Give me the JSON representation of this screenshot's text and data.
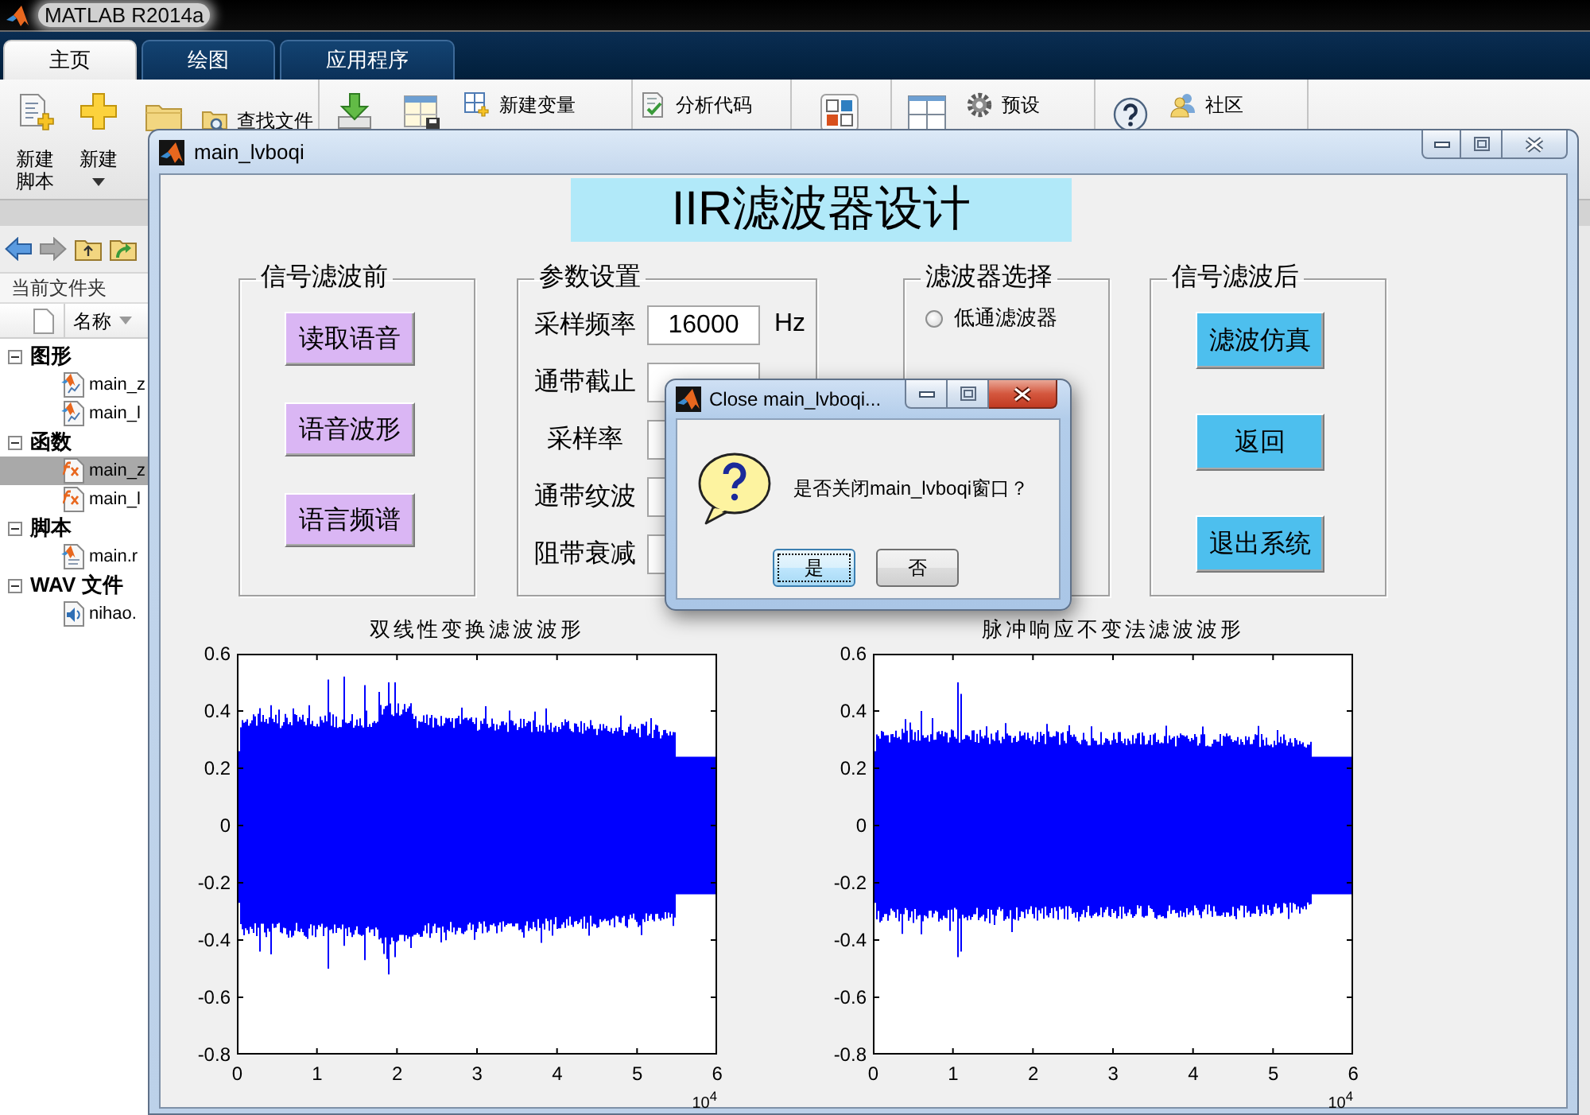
{
  "matlab_window": {
    "title": "MATLAB R2014a"
  },
  "ribbon_tabs": [
    {
      "label": "主页",
      "selected": true
    },
    {
      "label": "绘图",
      "selected": false
    },
    {
      "label": "应用程序",
      "selected": false
    }
  ],
  "toolstrip": {
    "new_script": "新建脚本",
    "new": "新建",
    "find_files": "查找文件",
    "new_variable": "新建变量",
    "analyze_code": "分析代码",
    "preferences": "预设",
    "community": "社区"
  },
  "current_folder": {
    "title": "当前文件夹",
    "column": "名称",
    "groups": [
      {
        "label": "图形",
        "kind": "figure",
        "expanded": true,
        "children": [
          {
            "name": "main_z",
            "selected": false
          },
          {
            "name": "main_l",
            "selected": false
          }
        ]
      },
      {
        "label": "函数",
        "kind": "function",
        "expanded": true,
        "children": [
          {
            "name": "main_z",
            "selected": true
          },
          {
            "name": "main_l",
            "selected": false
          }
        ]
      },
      {
        "label": "脚本",
        "kind": "script",
        "expanded": true,
        "children": [
          {
            "name": "main.r",
            "selected": false
          }
        ]
      },
      {
        "label": "WAV 文件",
        "kind": "audio",
        "expanded": true,
        "children": [
          {
            "name": "nihao.",
            "selected": false
          }
        ]
      }
    ]
  },
  "figure_window": {
    "title": "main_lvboqi",
    "heading": "IIR滤波器设计",
    "panels": [
      {
        "kind": "buttons",
        "title": "信号滤波前",
        "color": "#dab6f4",
        "buttons": [
          "读取语音",
          "语音波形",
          "语言频谱"
        ]
      },
      {
        "kind": "params",
        "title": "参数设置",
        "rows": [
          {
            "label": "采样频率",
            "value": "16000",
            "unit": "Hz"
          },
          {
            "label": "通带截止"
          },
          {
            "label": "采样率"
          },
          {
            "label": "通带纹波"
          },
          {
            "label": "阻带衰减"
          }
        ]
      },
      {
        "kind": "radios",
        "title": "滤波器选择",
        "options": [
          {
            "label": "低通滤波器",
            "selected": false
          }
        ]
      },
      {
        "kind": "buttons",
        "title": "信号滤波后",
        "color": "#4dbfee",
        "buttons": [
          "滤波仿真",
          "返回",
          "退出系统"
        ]
      }
    ],
    "plots": [
      {
        "title": "双线性变换滤波波形",
        "y_tick_labels": [
          "0.6",
          "0.4",
          "0.2",
          "0",
          "-0.2",
          "-0.4",
          "-0.6",
          "-0.8"
        ],
        "x_tick_labels": [
          "0",
          "1",
          "2",
          "3",
          "4",
          "5",
          "6"
        ],
        "x_exponent": "10$^{4}$"
      },
      {
        "title": "脉冲响应不变法滤波波形",
        "y_tick_labels": [
          "0.6",
          "0.4",
          "0.2",
          "0",
          "-0.2",
          "-0.4",
          "-0.6",
          "-0.8"
        ],
        "x_tick_labels": [
          "0",
          "1",
          "2",
          "3",
          "4",
          "5",
          "6"
        ],
        "x_exponent": "10$^{4}$"
      }
    ]
  },
  "dialog": {
    "title": "Close main_lvboqi...",
    "message": "是否关闭main_lvboqi窗口？",
    "buttons": [
      {
        "label": "是",
        "focused": true
      },
      {
        "label": "否",
        "focused": false
      }
    ]
  }
}
